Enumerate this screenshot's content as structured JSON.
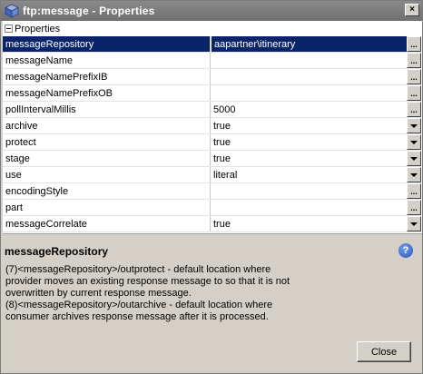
{
  "window": {
    "title": "ftp:message - Properties",
    "close_glyph": "×",
    "icon": "cube-icon"
  },
  "sheet": {
    "section_label": "Properties",
    "rows": [
      {
        "name": "messageRepository",
        "value": "aapartner\\itinerary",
        "control": "ellipsis"
      },
      {
        "name": "messageName",
        "value": "",
        "control": "ellipsis"
      },
      {
        "name": "messageNamePrefixIB",
        "value": "",
        "control": "ellipsis"
      },
      {
        "name": "messageNamePrefixOB",
        "value": "",
        "control": "ellipsis"
      },
      {
        "name": "pollIntervalMillis",
        "value": "5000",
        "control": "ellipsis"
      },
      {
        "name": "archive",
        "value": "true",
        "control": "dropdown"
      },
      {
        "name": "protect",
        "value": "true",
        "control": "dropdown"
      },
      {
        "name": "stage",
        "value": "true",
        "control": "dropdown"
      },
      {
        "name": "use",
        "value": "literal",
        "control": "dropdown"
      },
      {
        "name": "encodingStyle",
        "value": "",
        "control": "ellipsis"
      },
      {
        "name": "part",
        "value": "",
        "control": "ellipsis"
      },
      {
        "name": "messageCorrelate",
        "value": "true",
        "control": "dropdown"
      }
    ],
    "ellipsis_label": "...",
    "selected_index": 0
  },
  "description": {
    "title": "messageRepository",
    "lines": [
      "(7)<messageRepository>/outprotect - default location where",
      "provider moves an existing response message to so that it is not",
      "overwritten by current response message.",
      "(8)<messageRepository>/outarchive - default location where",
      "consumer archives response message after it is processed."
    ],
    "help_glyph": "?"
  },
  "footer": {
    "close_label": "Close"
  },
  "colors": {
    "selection": "#0a246a",
    "titlebar": "#7a7a7a",
    "face": "#d4d0c8"
  }
}
